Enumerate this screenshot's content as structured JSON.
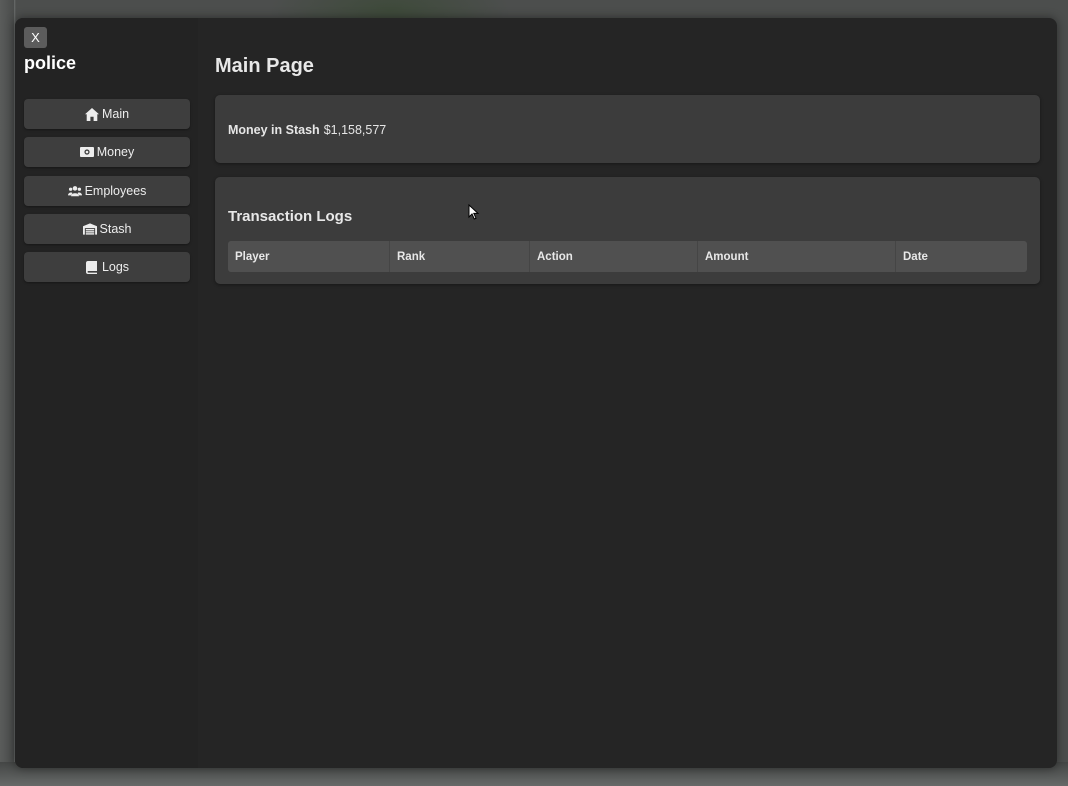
{
  "app": {
    "close_label": "X",
    "org_name": "police"
  },
  "sidebar": {
    "items": [
      {
        "label": "Main",
        "icon": "home-icon"
      },
      {
        "label": "Money",
        "icon": "money-bill-icon"
      },
      {
        "label": "Employees",
        "icon": "users-icon"
      },
      {
        "label": "Stash",
        "icon": "warehouse-icon"
      },
      {
        "label": "Logs",
        "icon": "book-icon"
      }
    ]
  },
  "main": {
    "page_title": "Main Page",
    "money": {
      "label": "Money in Stash",
      "value": "$1,158,577"
    },
    "logs": {
      "title": "Transaction Logs",
      "columns": [
        "Player",
        "Rank",
        "Action",
        "Amount",
        "Date"
      ]
    }
  },
  "colors": {
    "window_bg": "#252525",
    "card_bg": "#3c3c3c",
    "button_bg": "#3e3e3e",
    "table_header_bg": "#505050",
    "text": "#e8e8e8"
  }
}
